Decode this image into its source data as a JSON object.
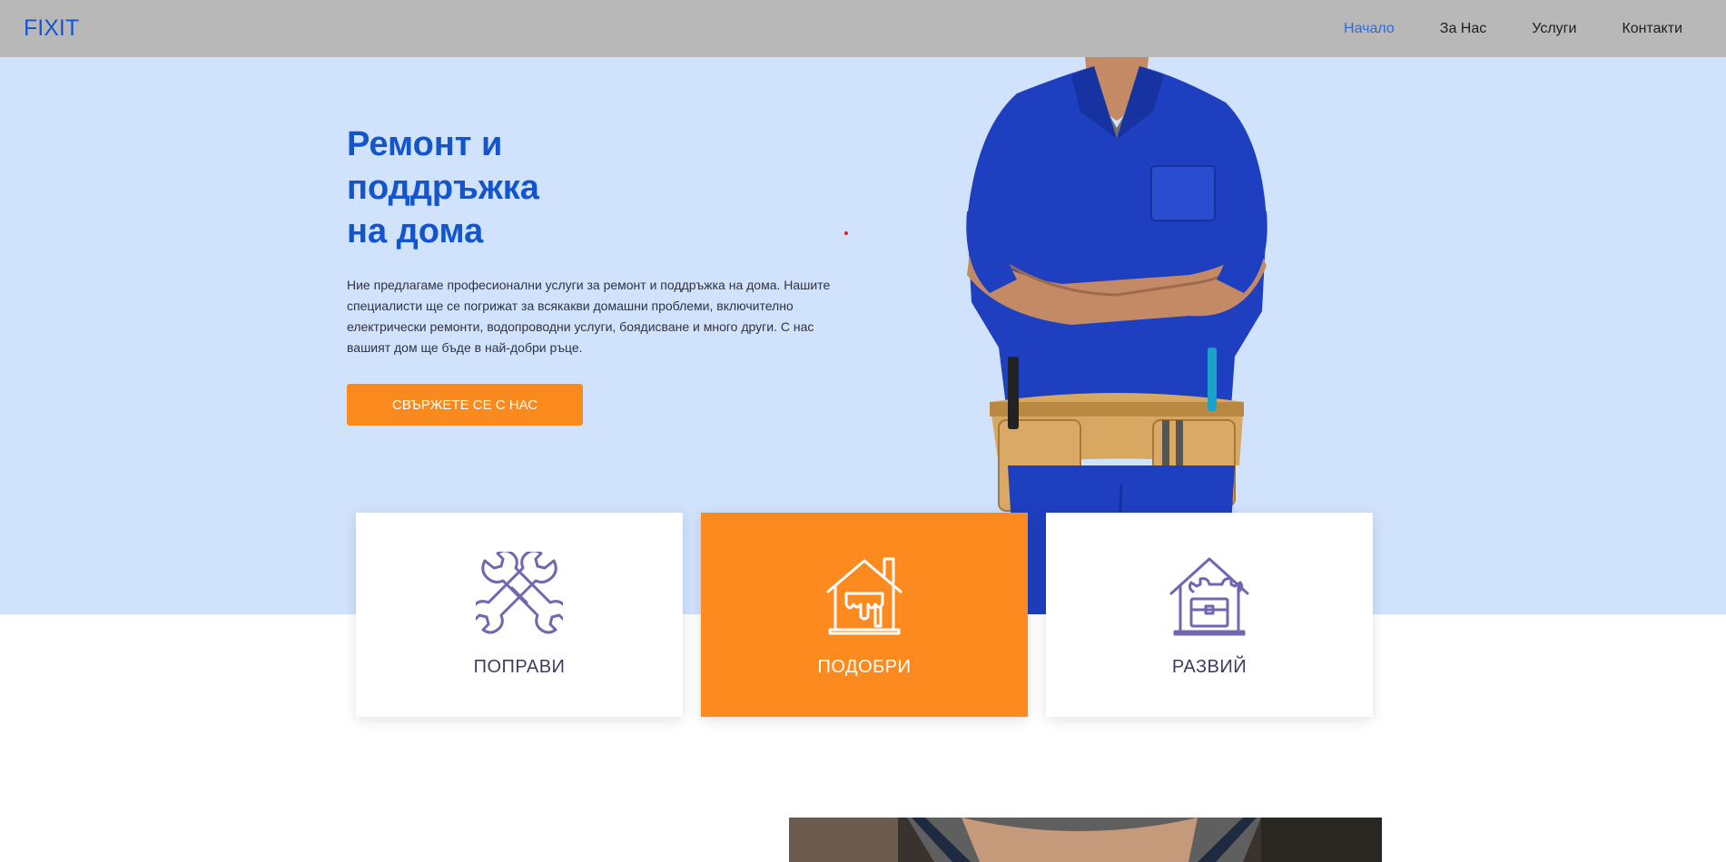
{
  "header": {
    "logo": "FIXIT",
    "nav": [
      {
        "label": "Начало",
        "active": true
      },
      {
        "label": "За Нас",
        "active": false
      },
      {
        "label": "Услуги",
        "active": false
      },
      {
        "label": "Контакти",
        "active": false
      }
    ]
  },
  "hero": {
    "title_lines": [
      "Ремонт и",
      "поддръжка",
      "на дома"
    ],
    "description": "Ние предлагаме професионални услуги за ремонт и поддръжка на дома. Нашите специалисти ще се погрижат за всякакви домашни проблеми, включително електрически ремонти, водопроводни услуги, боядисване и много други. С нас вашият дом ще бъде в най-добри ръце.",
    "cta_label": "СВЪРЖЕТЕ СЕ С НАС"
  },
  "cards": [
    {
      "label": "ПОПРАВИ",
      "icon": "crossed-wrenches-icon"
    },
    {
      "label": "ПОДОБРИ",
      "icon": "house-paint-icon"
    },
    {
      "label": "РАЗВИЙ",
      "icon": "house-toolbox-icon"
    }
  ],
  "colors": {
    "header_bg": "#b8b8b8",
    "brand_blue": "#1255cc",
    "hero_bg": "#d1e2fd",
    "accent_orange": "#fb8a1e",
    "icon_purple": "#6f67b0"
  }
}
